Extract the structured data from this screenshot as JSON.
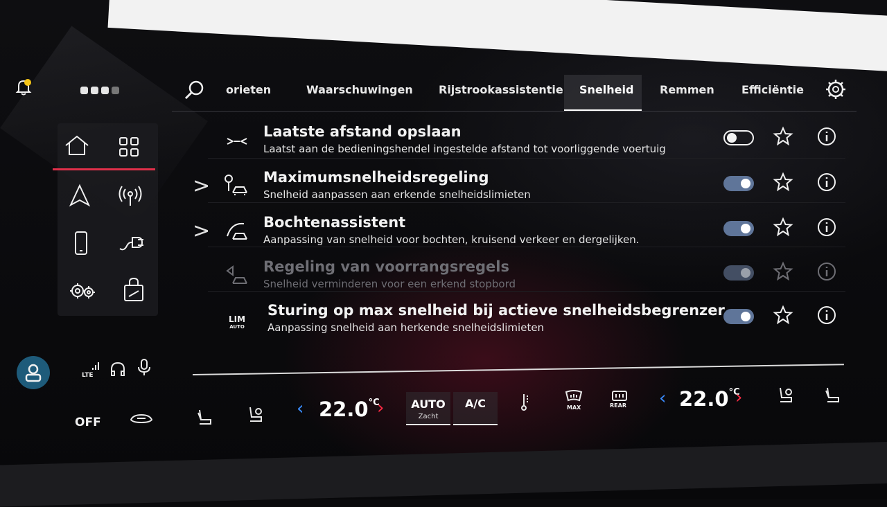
{
  "status": {
    "page_dots": 4,
    "network": "LTE"
  },
  "tabs": [
    {
      "label": "orieten",
      "active": false
    },
    {
      "label": "Waarschuwingen",
      "active": false
    },
    {
      "label": "Rijstrookassistentie",
      "active": false
    },
    {
      "label": "Snelheid",
      "active": true
    },
    {
      "label": "Remmen",
      "active": false
    },
    {
      "label": "Efficiëntie",
      "active": false
    }
  ],
  "settings": [
    {
      "title": "Laatste afstand opslaan",
      "subtitle": "Laatst aan de bedieningshendel ingestelde afstand tot voorliggende voertuig",
      "has_submenu": false,
      "enabled": false,
      "disabled_row": false
    },
    {
      "title": "Maximumsnelheidsregeling",
      "subtitle": "Snelheid aanpassen aan erkende snelheidslimieten",
      "has_submenu": true,
      "enabled": true,
      "disabled_row": false
    },
    {
      "title": "Bochtenassistent",
      "subtitle": "Aanpassing van snelheid voor bochten, kruisend verkeer en dergelijken.",
      "has_submenu": true,
      "enabled": true,
      "disabled_row": false
    },
    {
      "title": "Regeling van voorrangsregels",
      "subtitle": "Snelheid verminderen voor een erkend stopbord",
      "has_submenu": false,
      "enabled": true,
      "disabled_row": true
    },
    {
      "title": "Sturing op max snelheid bij actieve snelheidsbegrenzer",
      "subtitle": "Aanpassing snelheid aan herkende snelheidslimieten",
      "has_submenu": false,
      "enabled": true,
      "disabled_row": false,
      "icon_text": "LIM",
      "icon_subtext": "AUTO"
    }
  ],
  "chevron": ">",
  "climate": {
    "off_label": "OFF",
    "left_temp": "22.0",
    "right_temp": "22.0",
    "unit": "°C",
    "arrow_left": "‹",
    "arrow_right": "›",
    "auto_label": "AUTO",
    "auto_sub": "Zacht",
    "ac_label": "A/C",
    "max_label": "MAX",
    "rear_label": "REAR"
  },
  "colors": {
    "accent_red": "#e0304a",
    "toggle_on": "#5f7599",
    "temp_down": "#3a8cff",
    "temp_up": "#ff2a44",
    "avatar": "#1e5b7a"
  },
  "icons": [
    "bell-icon",
    "home-icon",
    "apps-grid-icon",
    "navigation-icon",
    "radio-signal-icon",
    "phone-icon",
    "charging-plug-icon",
    "gears-icon",
    "store-bag-icon",
    "search-icon",
    "gear-icon",
    "star-icon",
    "info-icon",
    "user-icon",
    "headset-icon",
    "microphone-icon",
    "car-icon",
    "seat-heat-icon",
    "seat-ventilation-icon",
    "windshield-max-icon",
    "rear-defrost-icon",
    "thermometer-icon"
  ]
}
